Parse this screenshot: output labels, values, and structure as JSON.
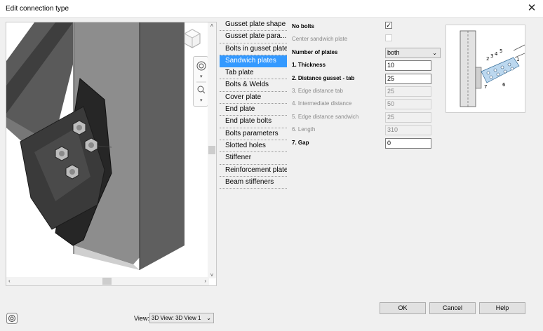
{
  "window": {
    "title": "Edit connection type",
    "close_glyph": "✕"
  },
  "tabs": [
    {
      "label": "Gusset plate shape",
      "active": false
    },
    {
      "label": "Gusset plate para...",
      "active": false
    },
    {
      "label": "Bolts in gusset plate",
      "active": false
    },
    {
      "label": "Sandwich plates",
      "active": true
    },
    {
      "label": "Tab plate",
      "active": false
    },
    {
      "label": "Bolts & Welds",
      "active": false
    },
    {
      "label": "Cover plate",
      "active": false
    },
    {
      "label": "End plate",
      "active": false
    },
    {
      "label": "End plate bolts",
      "active": false
    },
    {
      "label": "Bolts  parameters",
      "active": false
    },
    {
      "label": "Slotted holes",
      "active": false
    },
    {
      "label": "Stiffener",
      "active": false
    },
    {
      "label": "Reinforcement plate",
      "active": false
    },
    {
      "label": "Beam stiffeners",
      "active": false
    }
  ],
  "params": {
    "no_bolts": {
      "label": "No bolts",
      "checked_glyph": "✓"
    },
    "center_sandwich": {
      "label": "Center sandwich plate"
    },
    "number_of_plates": {
      "label": "Number of plates",
      "value": "both"
    },
    "thickness": {
      "label": "1. Thickness",
      "value": "10"
    },
    "distance_gusset_tab": {
      "label": "2. Distance gusset - tab",
      "value": "25"
    },
    "edge_distance_tab": {
      "label": "3. Edge distance tab",
      "value": "25"
    },
    "intermediate_distance": {
      "label": "4. Intermediate distance",
      "value": "50"
    },
    "edge_distance_sandwich": {
      "label": "5. Edge distance sandwich",
      "value": "25"
    },
    "length": {
      "label": "6. Length",
      "value": "310"
    },
    "gap": {
      "label": "7. Gap",
      "value": "0"
    }
  },
  "preview": {
    "labels": [
      "2",
      "3",
      "4",
      "5",
      "6",
      "7",
      "1"
    ]
  },
  "view": {
    "label": "View:",
    "value": "3D View: 3D View 1"
  },
  "buttons": {
    "ok": "OK",
    "cancel": "Cancel",
    "help": "Help"
  },
  "colors": {
    "selection": "#3399ff",
    "dialog_bg": "#f0f0f0"
  }
}
